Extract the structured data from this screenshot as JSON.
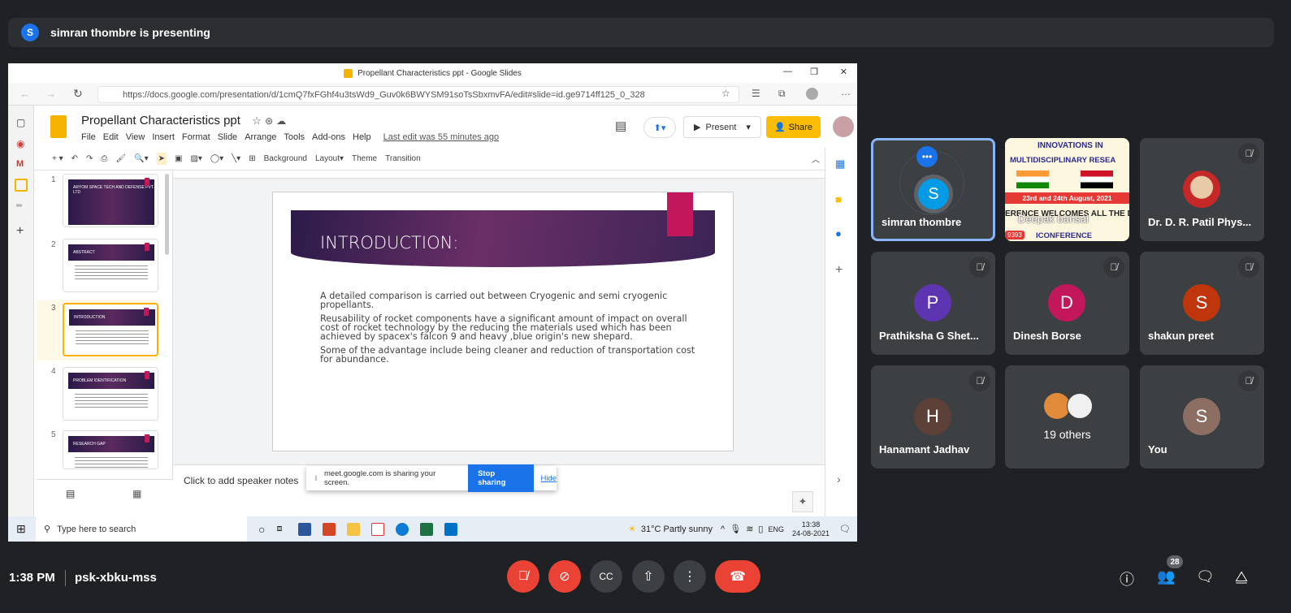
{
  "presenter": {
    "avatar_letter": "S",
    "text": "simran thombre is presenting",
    "avatar_color": "#1a73e8"
  },
  "browser": {
    "window_title": "Propellant Characteristics ppt - Google Slides",
    "url": "https://docs.google.com/presentation/d/1cmQ7fxFGhf4u3tsWd9_Guv0k6BWYSM91soTsSbxmvFA/edit#slide=id.ge9714ff125_0_328"
  },
  "slides": {
    "doc_title": "Propellant Characteristics ppt",
    "menus": [
      "File",
      "Edit",
      "View",
      "Insert",
      "Format",
      "Slide",
      "Arrange",
      "Tools",
      "Add-ons",
      "Help"
    ],
    "last_edit": "Last edit was 55 minutes ago",
    "present_label": "Present",
    "share_label": "Share",
    "toolbar": [
      "Background",
      "Layout▾",
      "Theme",
      "Transition"
    ],
    "thumbnails": [
      {
        "num": "1",
        "title": "ARYOM SPACE TECH AND DEFENSE PVT. LTD"
      },
      {
        "num": "2",
        "title": "ABSTRACT"
      },
      {
        "num": "3",
        "title": "INTRODUCTION"
      },
      {
        "num": "4",
        "title": "PROBLEM IDENTIFICATION"
      },
      {
        "num": "5",
        "title": "RESEARCH GAP"
      }
    ],
    "current_slide": {
      "title": "INTRODUCTION:",
      "paragraphs": [
        "A detailed comparison is carried out between Cryogenic and semi cryogenic propellants.",
        "Reusability of rocket components have a significant amount of impact on overall cost of rocket technology by the reducing the materials used which has been achieved by spacex's falcon 9 and heavy ,blue origin's new shepard.",
        "Some of the advantage include being cleaner and reduction of transportation cost for abundance."
      ]
    },
    "speaker_notes_placeholder": "Click to add speaker notes"
  },
  "share_banner": {
    "text": "meet.google.com is sharing your screen.",
    "stop": "Stop sharing",
    "hide": "Hide"
  },
  "taskbar": {
    "search_placeholder": "Type here to search",
    "weather": "31°C  Partly sunny",
    "lang": "ENG",
    "time": "13:38",
    "date": "24-08-2021"
  },
  "participants": [
    {
      "name": "simran thombre",
      "letter": "S",
      "color": "#039be5"
    },
    {
      "name": "Deepak bansal",
      "banner": [
        "INNOVATIONS IN",
        "MULTIDISCIPLINARY RESEA",
        "23rd and 24th August, 2021",
        "ERENCE WELCOMES ALL THE DEL",
        "ICONFERENCE",
        "9393"
      ]
    },
    {
      "name": "Dr. D. R. Patil Phys...",
      "letter": ""
    },
    {
      "name": "Prathiksha G Shet...",
      "letter": "P",
      "color": "#5e35b1"
    },
    {
      "name": "Dinesh Borse",
      "letter": "D",
      "color": "#c2185b"
    },
    {
      "name": "shakun preet",
      "letter": "S",
      "color": "#bf360c"
    },
    {
      "name": "Hanamant Jadhav",
      "letter": "H",
      "color": "#5d4037"
    },
    {
      "name": "19 others",
      "letter": ""
    },
    {
      "name": "You",
      "letter": "S",
      "color": "#8d6e63"
    }
  ],
  "meeting": {
    "time": "1:38 PM",
    "code": "psk-xbku-mss",
    "participant_count": "28"
  }
}
